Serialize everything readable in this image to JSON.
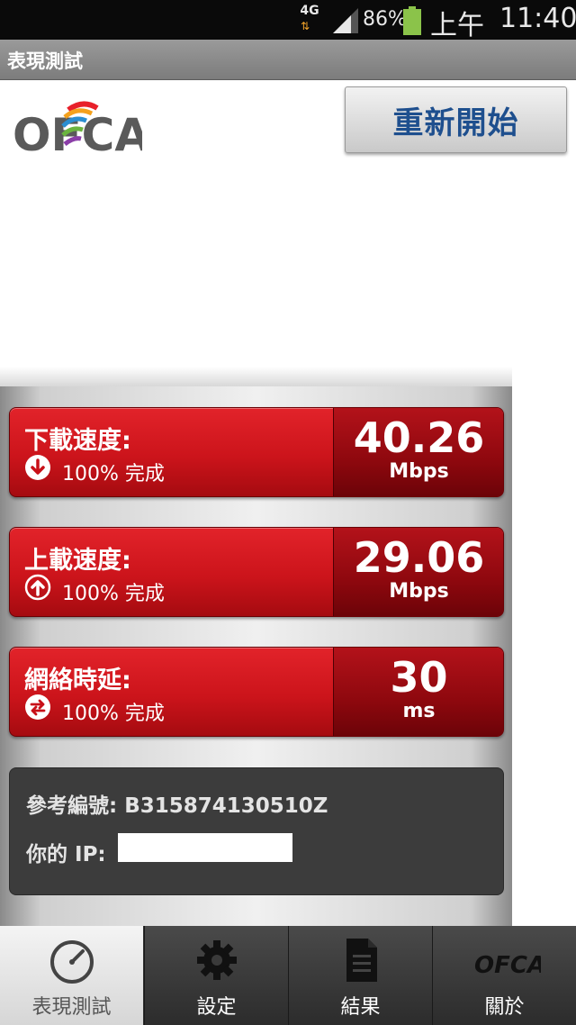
{
  "status_bar": {
    "network": "4G",
    "battery": "86%",
    "ampm": "上午",
    "time": "11:40"
  },
  "title_bar": {
    "title": "表現測試"
  },
  "header": {
    "logo": "OFCA",
    "restart_label": "重新開始"
  },
  "metrics": [
    {
      "label": "下載速度:",
      "icon": "download-icon",
      "progress": "100% 完成",
      "value": "40.26",
      "unit": "Mbps"
    },
    {
      "label": "上載速度:",
      "icon": "upload-icon",
      "progress": "100% 完成",
      "value": "29.06",
      "unit": "Mbps"
    },
    {
      "label": "網絡時延:",
      "icon": "latency-icon",
      "progress": "100% 完成",
      "value": "30",
      "unit": "ms"
    }
  ],
  "info": {
    "reference_label": "參考編號:",
    "reference_value": "B315874130510Z",
    "ip_label": "你的 IP:"
  },
  "nav": {
    "tabs": [
      {
        "label": "表現測試",
        "icon": "speedometer-icon",
        "active": true
      },
      {
        "label": "設定",
        "icon": "gear-icon",
        "active": false
      },
      {
        "label": "結果",
        "icon": "document-icon",
        "active": false
      },
      {
        "label": "關於",
        "icon": "ofca-logo-icon",
        "active": false
      }
    ]
  },
  "colors": {
    "metric_red": "#cc141b",
    "metric_dark": "#8e080e",
    "button_text": "#1e4f8e",
    "info_bg": "#3c3c3c"
  }
}
